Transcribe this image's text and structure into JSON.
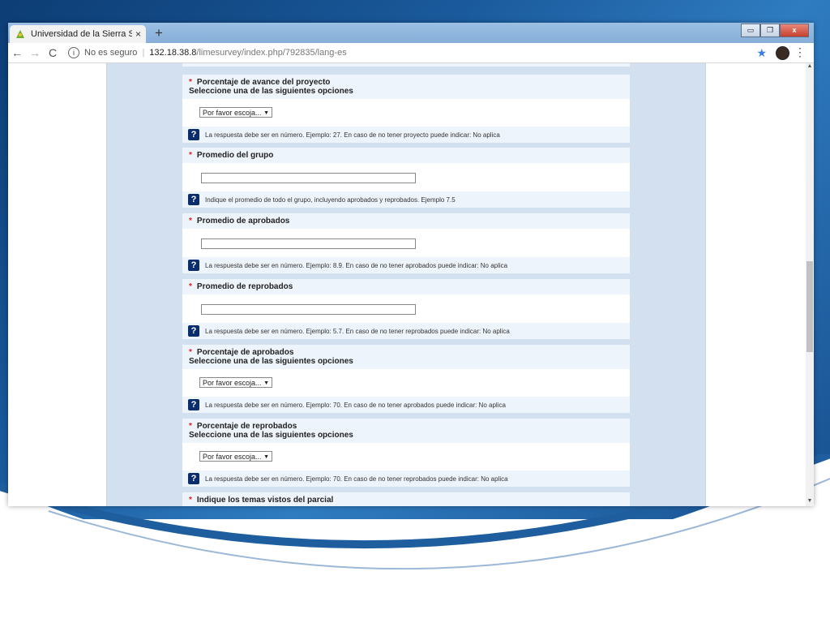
{
  "browser": {
    "tab_title": "Universidad de la Sierra Sur. Ava",
    "tab_close": "×",
    "new_tab": "+",
    "window_controls": {
      "minimize": "▭",
      "restore": "❐",
      "close": "x"
    },
    "back": "←",
    "forward": "→",
    "reload": "C",
    "security_icon": "i",
    "security_text": "No es seguro",
    "separator": "|",
    "url_host": "132.18.38.8",
    "url_path": "/limesurvey/index.php/792835/lang-es",
    "bookmark_star": "★",
    "menu": "⋮"
  },
  "survey": {
    "questions": [
      {
        "title": "Porcentaje de avance del proyecto",
        "subtitle": "Seleccione una de las siguientes opciones",
        "input_type": "select",
        "select_value": "Por favor escoja...",
        "help": "La respuesta debe ser en número. Ejemplo: 27. En caso de no tener proyecto puede indicar: No aplica"
      },
      {
        "title": "Promedio del grupo",
        "input_type": "text",
        "help": "Indique el promedio de todo el grupo, incluyendo aprobados y reprobados. Ejemplo 7.5"
      },
      {
        "title": "Promedio de aprobados",
        "input_type": "text",
        "help": "La respuesta debe ser en número. Ejemplo: 8.9. En caso de no tener aprobados puede indicar: No aplica"
      },
      {
        "title": "Promedio de reprobados",
        "input_type": "text",
        "help": "La respuesta debe ser en número. Ejemplo: 5.7. En caso de no tener reprobados puede indicar: No aplica"
      },
      {
        "title": "Porcentaje de aprobados",
        "subtitle": "Seleccione una de las siguientes opciones",
        "input_type": "select",
        "select_value": "Por favor escoja...",
        "help": "La respuesta debe ser en número. Ejemplo: 70. En caso de no tener aprobados puede indicar: No aplica"
      },
      {
        "title": "Porcentaje de reprobados",
        "subtitle": "Seleccione una de las siguientes opciones",
        "input_type": "select",
        "select_value": "Por favor escoja...",
        "help": "La respuesta debe ser en número. Ejemplo: 70. En caso de no tener reprobados puede indicar: No aplica"
      },
      {
        "title": "Indique los temas vistos del parcial"
      }
    ],
    "required_marker": "*",
    "help_icon": "?",
    "select_arrow": "▼"
  },
  "scrollbar": {
    "up": "▲",
    "down": "▼"
  },
  "colors": {
    "required": "#e02020",
    "help_icon_bg": "#0a2d6e",
    "question_bg": "#eef4fb",
    "page_bg": "#d3e0ef"
  }
}
